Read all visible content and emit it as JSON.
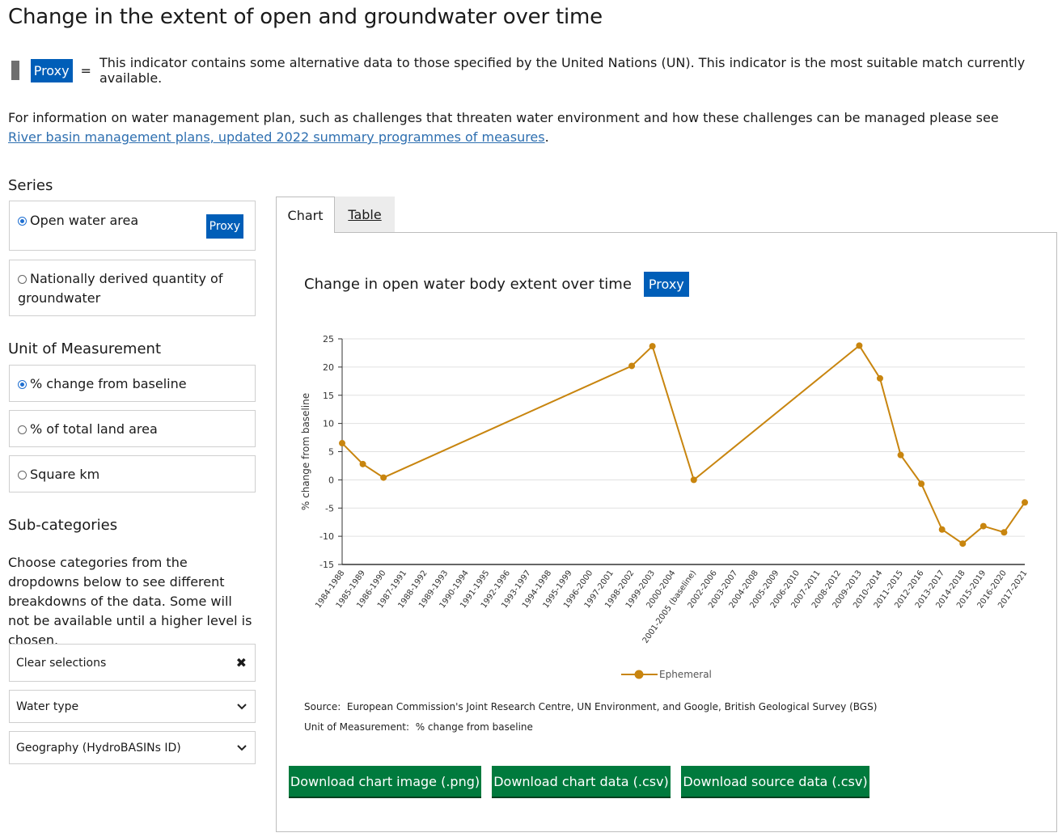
{
  "page_title": "Change in the extent of open and groundwater over time",
  "proxy": {
    "badge": "Proxy",
    "equals": "=",
    "description": "This indicator contains some alternative data to those specified by the United Nations (UN). This indicator is the most suitable match currently available."
  },
  "intro": {
    "text_before": "For information on water management plan, such as challenges that threaten water environment and how these challenges can be managed please see ",
    "link_text": "River basin management plans, updated 2022 summary programmes of measures",
    "text_after": "."
  },
  "series": {
    "heading": "Series",
    "options": [
      {
        "label": "Open water area",
        "selected": true,
        "badge": "Proxy"
      },
      {
        "label": "Nationally derived quantity of groundwater",
        "selected": false
      }
    ]
  },
  "units": {
    "heading": "Unit of Measurement",
    "options": [
      {
        "label": "% change from baseline",
        "selected": true
      },
      {
        "label": "% of total land area",
        "selected": false
      },
      {
        "label": "Square km",
        "selected": false
      }
    ]
  },
  "subcategories": {
    "heading": "Sub-categories",
    "help": "Choose categories from the dropdowns below to see different breakdowns of the data. Some will not be available until a higher level is chosen.",
    "clear": "Clear selections",
    "dropdowns": [
      "Water type",
      "Geography (HydroBASINs ID)"
    ]
  },
  "tabs": {
    "chart": "Chart",
    "table": "Table"
  },
  "chart_header": {
    "title": "Change in open water body extent over time",
    "badge": "Proxy"
  },
  "chart_data": {
    "type": "line",
    "title": "",
    "xlabel": "",
    "ylabel": "% change from baseline",
    "ylim": [
      -15,
      25
    ],
    "yticks": [
      25,
      20,
      15,
      10,
      5,
      0,
      -5,
      -10,
      -15
    ],
    "categories": [
      "1984-1988",
      "1985-1989",
      "1986-1990",
      "1987-1991",
      "1988-1992",
      "1989-1993",
      "1990-1994",
      "1991-1995",
      "1992-1996",
      "1993-1997",
      "1994-1998",
      "1995-1999",
      "1996-2000",
      "1997-2001",
      "1998-2002",
      "1999-2003",
      "2000-2004",
      "2001-2005 (baseline)",
      "2002-2006",
      "2003-2007",
      "2004-2008",
      "2005-2009",
      "2006-2010",
      "2007-2011",
      "2008-2012",
      "2009-2013",
      "2010-2014",
      "2011-2015",
      "2012-2016",
      "2013-2017",
      "2014-2018",
      "2015-2019",
      "2016-2020",
      "2017-2021"
    ],
    "grid": true,
    "legend_position": "bottom-center",
    "series": [
      {
        "name": "Ephemeral",
        "color": "#c8850f",
        "values": [
          6.5,
          2.8,
          0.4,
          null,
          null,
          null,
          null,
          null,
          null,
          null,
          null,
          null,
          null,
          null,
          20.2,
          23.7,
          null,
          0.0,
          null,
          null,
          null,
          null,
          null,
          null,
          null,
          23.8,
          18.0,
          4.4,
          -0.7,
          -8.8,
          -11.3,
          -8.2,
          -9.3,
          -4.0
        ]
      }
    ]
  },
  "source": {
    "label": "Source:",
    "text": "European Commission's Joint Research Centre, UN Environment, and Google, British Geological Survey (BGS)"
  },
  "unit_line": {
    "label": "Unit of Measurement:",
    "text": "% change from baseline"
  },
  "downloads": [
    "Download chart image (.png)",
    "Download chart data (.csv)",
    "Download source data (.csv)"
  ]
}
